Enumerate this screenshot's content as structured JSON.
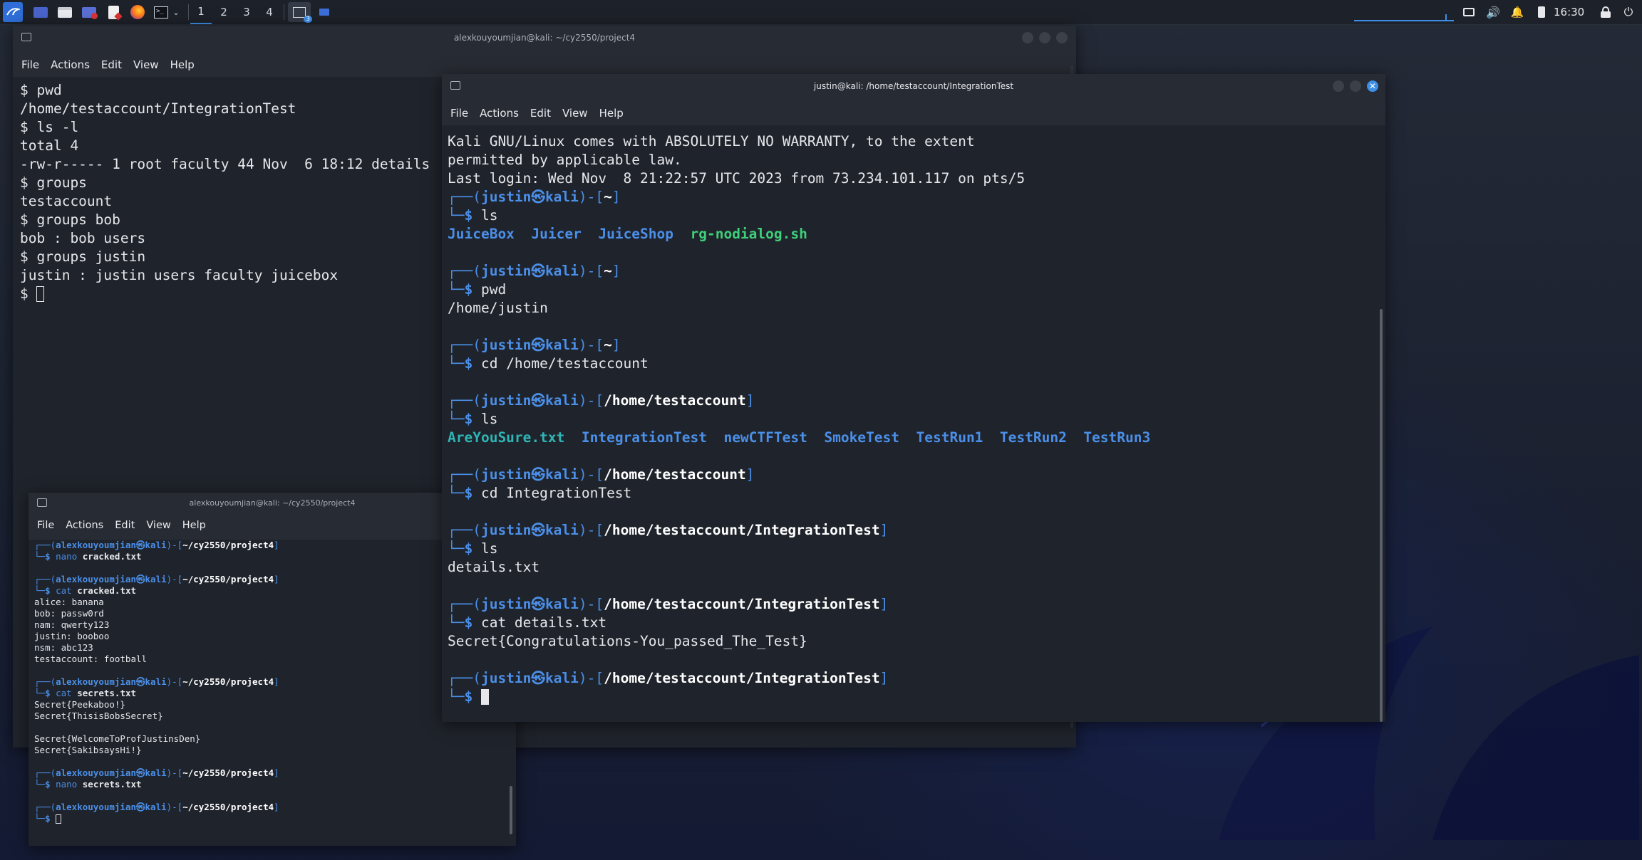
{
  "taskbar": {
    "workspaces": [
      "1",
      "2",
      "3",
      "4"
    ],
    "clock": "16:30",
    "icons": [
      "kali-menu-icon",
      "show-desktop-icon",
      "file-manager-icon",
      "mail-icon",
      "text-editor-icon",
      "firefox-icon",
      "terminal-icon",
      "chevron-down-icon",
      "terminal-task-icon",
      "window-task-icon",
      "screen-icon",
      "volume-icon",
      "bell-icon",
      "battery-icon",
      "lock-icon",
      "power-icon"
    ],
    "task_badge": "3"
  },
  "win1": {
    "title": "alexkouyoumjian@kali: ~/cy2550/project4",
    "menu": [
      "File",
      "Actions",
      "Edit",
      "View",
      "Help"
    ],
    "lines": [
      "$ pwd",
      "/home/testaccount/IntegrationTest",
      "$ ls -l",
      "total 4",
      "-rw-r----- 1 root faculty 44 Nov  6 18:12 details",
      "$ groups",
      "testaccount",
      "$ groups bob",
      "bob : bob users",
      "$ groups justin",
      "justin : justin users faculty juicebox",
      "$ "
    ]
  },
  "win2": {
    "title": "justin@kali: /home/testaccount/IntegrationTest",
    "menu": [
      "File",
      "Actions",
      "Edit",
      "View",
      "Help"
    ],
    "intro": [
      "Kali GNU/Linux comes with ABSOLUTELY NO WARRANTY, to the extent",
      "permitted by applicable law.",
      "Last login: Wed Nov  8 21:22:57 UTC 2023 from 73.234.101.117 on pts/5"
    ],
    "user": "justin",
    "host": "kali",
    "blocks": [
      {
        "path": "~",
        "cmd": "ls",
        "out_dirs": [
          "JuiceBox",
          "Juicer",
          "JuiceShop"
        ],
        "out_exec": [
          "rg-nodialog.sh"
        ],
        "out_text": []
      },
      {
        "path": "~",
        "cmd": "pwd",
        "out_dirs": [],
        "out_exec": [],
        "out_text": [
          "/home/justin"
        ]
      },
      {
        "path": "~",
        "cmd": "cd /home/testaccount",
        "out_dirs": [],
        "out_exec": [],
        "out_text": []
      },
      {
        "path": "/home/testaccount",
        "cmd": "ls",
        "out_file": "AreYouSure.txt",
        "out_dirs": [
          "IntegrationTest",
          "newCTFTest",
          "SmokeTest",
          "TestRun1",
          "TestRun2",
          "TestRun3"
        ],
        "out_exec": [],
        "out_text": []
      },
      {
        "path": "/home/testaccount",
        "cmd": "cd IntegrationTest",
        "out_dirs": [],
        "out_exec": [],
        "out_text": []
      },
      {
        "path": "/home/testaccount/IntegrationTest",
        "cmd": "ls",
        "out_dirs": [],
        "out_exec": [],
        "out_text": [
          "details.txt"
        ]
      },
      {
        "path": "/home/testaccount/IntegrationTest",
        "cmd": "cat details.txt",
        "out_dirs": [],
        "out_exec": [],
        "out_text": [
          "Secret{Congratulations-You_passed_The_Test}"
        ]
      },
      {
        "path": "/home/testaccount/IntegrationTest",
        "cmd": "",
        "out_dirs": [],
        "out_exec": [],
        "out_text": []
      }
    ]
  },
  "win3": {
    "title": "alexkouyoumjian@kali: ~/cy2550/project4",
    "menu": [
      "File",
      "Actions",
      "Edit",
      "View",
      "Help"
    ],
    "user": "alexkouyoumjian",
    "host": "kali",
    "path": "~/cy2550/project4",
    "blocks": [
      {
        "cmd": "nano",
        "arg": "cracked.txt",
        "out": []
      },
      {
        "cmd": "cat",
        "arg": "cracked.txt",
        "out": [
          "alice: banana",
          "bob: passw0rd",
          "nam: qwerty123",
          "justin: booboo",
          "nsm: abc123",
          "testaccount: football"
        ]
      },
      {
        "cmd": "cat",
        "arg": "secrets.txt",
        "out": [
          "Secret{Peekaboo!}",
          "Secret{ThisisBobsSecret}",
          "",
          "Secret{WelcomeToProfJustinsDen}",
          "Secret{SakibsaysHi!}"
        ]
      },
      {
        "cmd": "nano",
        "arg": "secrets.txt",
        "out": []
      },
      {
        "cmd": "",
        "arg": "",
        "out": []
      }
    ]
  },
  "colors": {
    "prompt_blue": "#4b8fe8",
    "dir_blue": "#4b8fe8",
    "exec_green": "#3fcf7a",
    "file_cyan": "#2fb5b5",
    "close_blue": "#3d8fe8"
  }
}
